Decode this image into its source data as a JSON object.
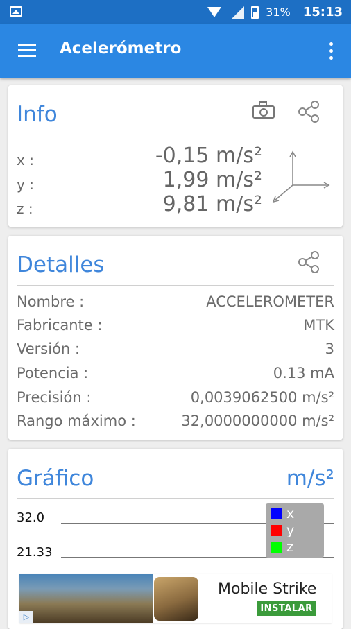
{
  "status_bar": {
    "battery": "31%",
    "time": "15:13"
  },
  "app_bar": {
    "title": "Acelerómetro"
  },
  "info": {
    "title": "Info",
    "rows": [
      {
        "label": "x :",
        "value": "-0,15 m/s²"
      },
      {
        "label": "y :",
        "value": "1,99 m/s²"
      },
      {
        "label": "z :",
        "value": "9,81 m/s²"
      }
    ]
  },
  "details": {
    "title": "Detalles",
    "rows": [
      {
        "label": "Nombre :",
        "value": "ACCELEROMETER"
      },
      {
        "label": "Fabricante :",
        "value": "MTK"
      },
      {
        "label": "Versión :",
        "value": "3"
      },
      {
        "label": "Potencia :",
        "value": "0.13 mA"
      },
      {
        "label": "Precisión :",
        "value": "0,0039062500 m/s²"
      },
      {
        "label": "Rango máximo :",
        "value": "32,0000000000 m/s²"
      }
    ]
  },
  "graph": {
    "title": "Gráfico",
    "unit": "m/s²",
    "ticks": [
      "32.0",
      "21.33"
    ],
    "legend": [
      {
        "label": "x",
        "color": "#0000ff"
      },
      {
        "label": "y",
        "color": "#ff0000"
      },
      {
        "label": "z",
        "color": "#00ff00"
      }
    ]
  },
  "ad": {
    "app_name": "Mobile Strike",
    "button": "INSTALAR"
  }
}
